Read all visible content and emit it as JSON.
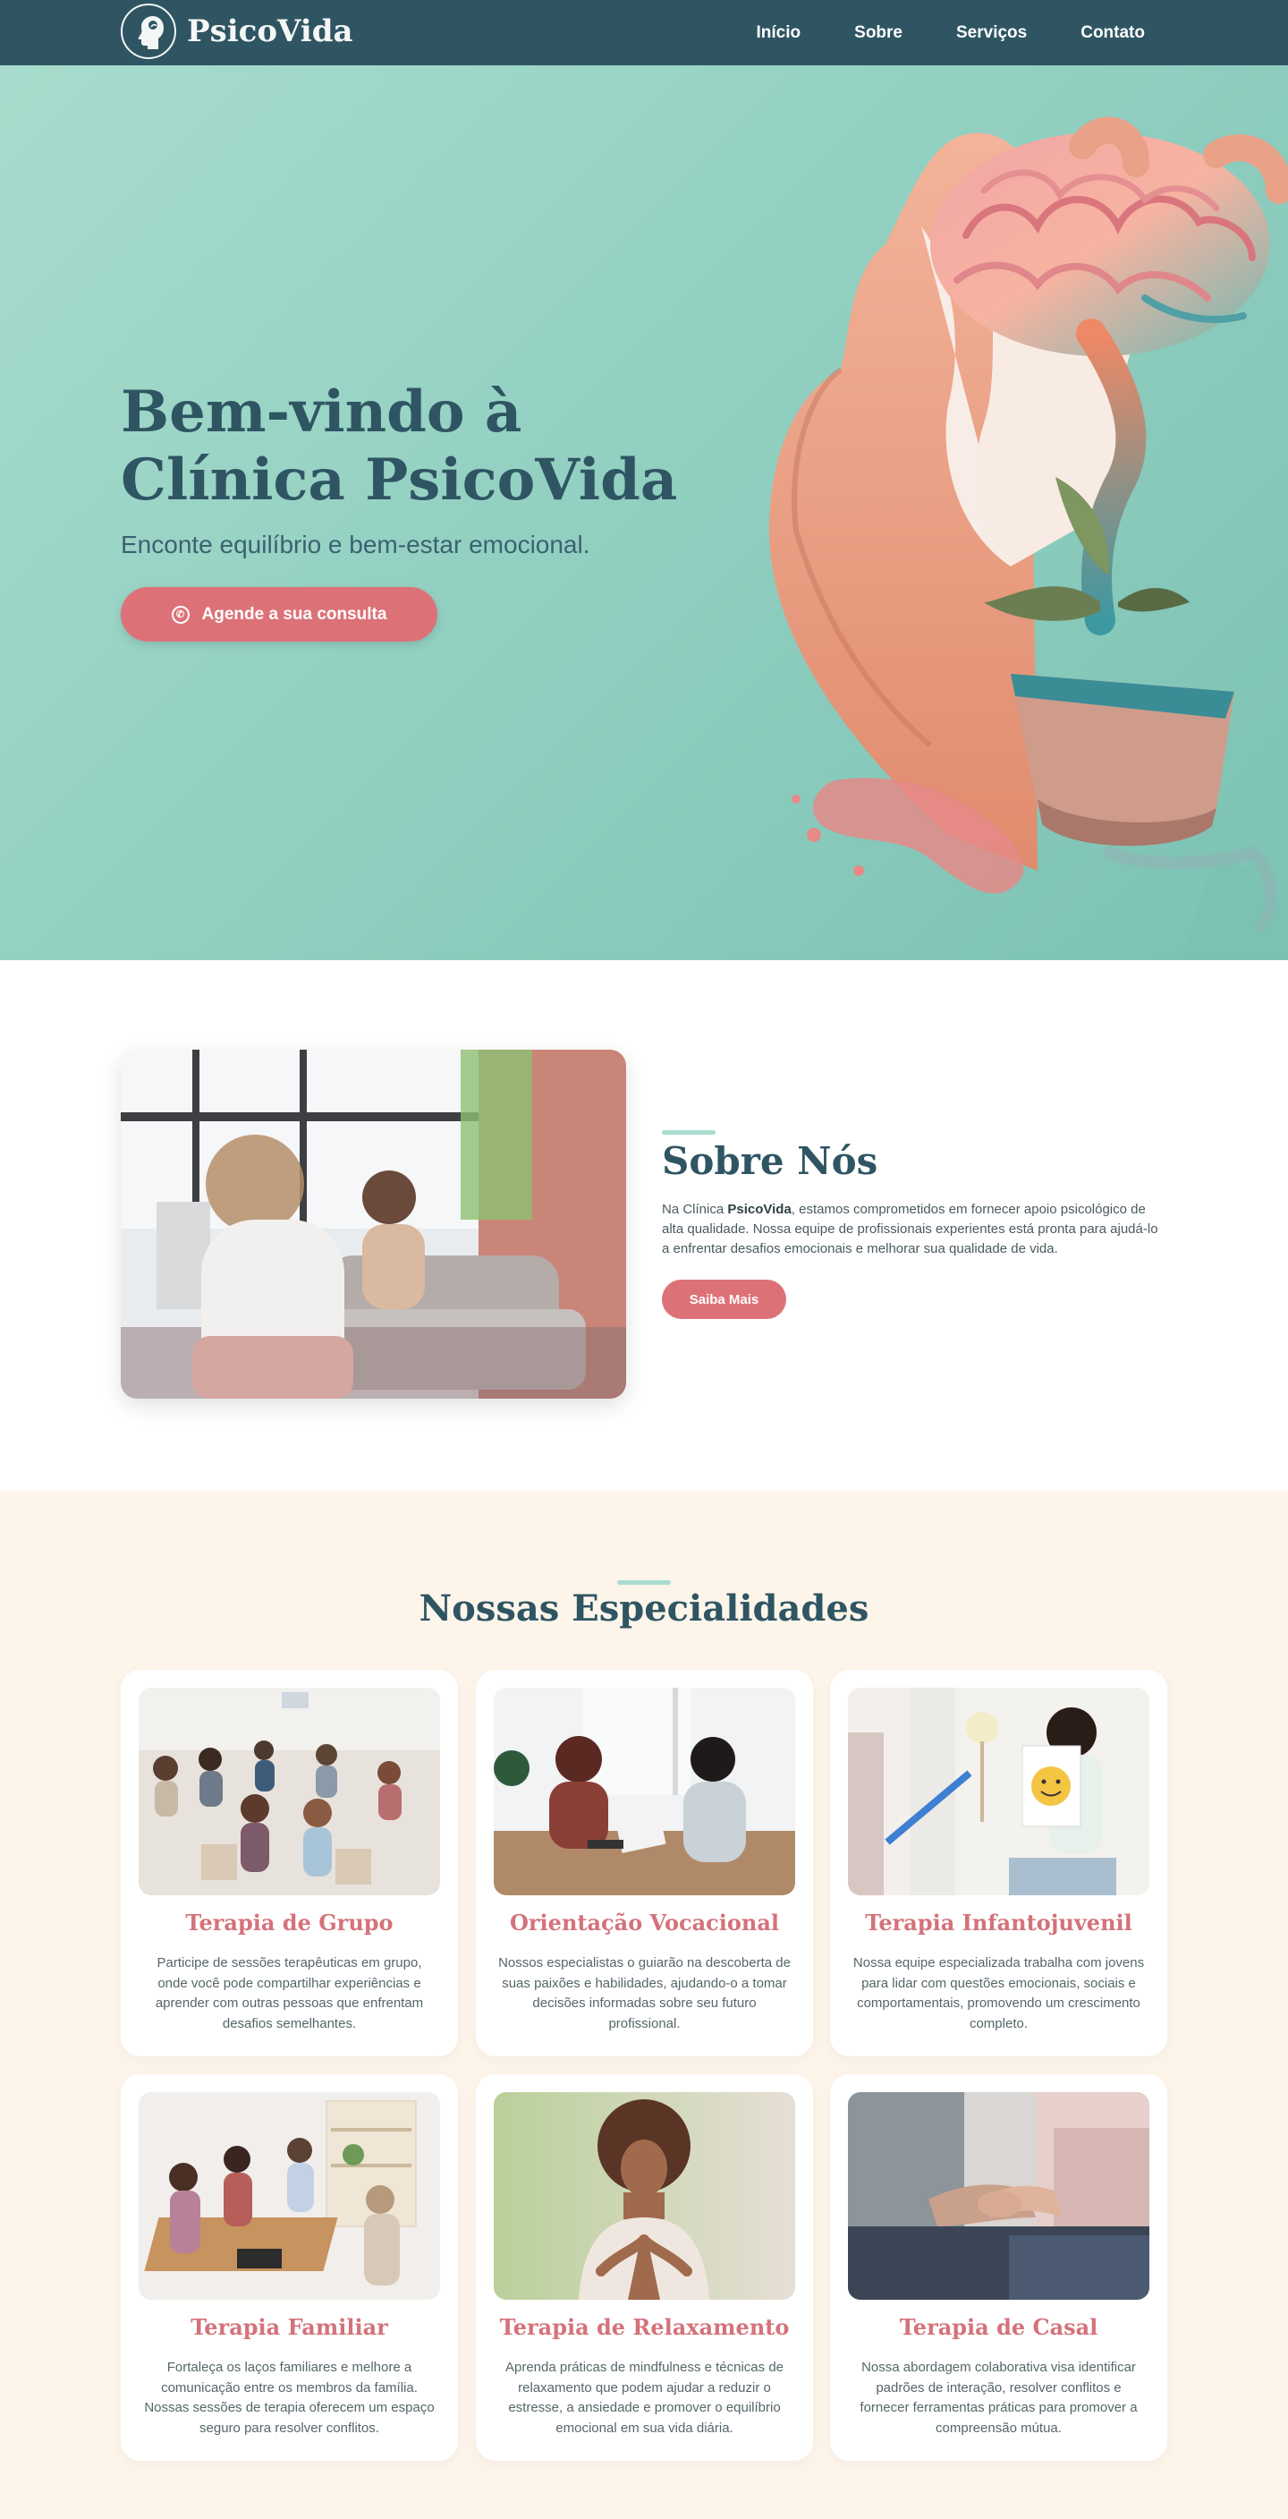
{
  "nav": {
    "brand": "PsicoVida",
    "links": [
      "Início",
      "Sobre",
      "Serviços",
      "Contato"
    ]
  },
  "hero": {
    "title": "Bem-vindo à Clínica PsicoVida",
    "subtitle": "Enconte equilíbrio e bem-estar emocional.",
    "cta_label": "Agende a sua consulta",
    "cta_icon": "whatsapp-icon"
  },
  "about": {
    "title": "Sobre Nós",
    "text_before": "Na Clínica ",
    "text_bold": "PsicoVida",
    "text_after": ", estamos comprometidos em fornecer apoio psicológico de alta qualidade. Nossa equipe de profissionais experientes está pronta para ajudá-lo a enfrentar desafios emocionais e melhorar sua qualidade de vida.",
    "button_label": "Saiba Mais"
  },
  "specialties": {
    "title": "Nossas Especialidades",
    "cards": [
      {
        "title": "Terapia de Grupo",
        "text": "Participe de sessões terapêuticas em grupo, onde você pode compartilhar experiências e aprender com outras pessoas que enfrentam desafios semelhantes."
      },
      {
        "title": "Orientação Vocacional",
        "text": "Nossos especialistas o guiarão na descoberta de suas paixões e habilidades, ajudando-o a tomar decisões informadas sobre seu futuro profissional."
      },
      {
        "title": "Terapia Infantojuvenil",
        "text": "Nossa equipe especializada trabalha com jovens para lidar com questões emocionais, sociais e comportamentais, promovendo um crescimento completo."
      },
      {
        "title": "Terapia Familiar",
        "text": "Fortaleça os laços familiares e melhore a comunicação entre os membros da família. Nossas sessões de terapia oferecem um espaço seguro para resolver conflitos."
      },
      {
        "title": "Terapia de Relaxamento",
        "text": "Aprenda práticas de mindfulness e técnicas de relaxamento que podem ajudar a reduzir o estresse, a ansiedade e promover o equilíbrio emocional em sua vida diária."
      },
      {
        "title": "Terapia de Casal",
        "text": "Nossa abordagem colaborativa visa identificar padrões de interação, resolver conflitos e fornecer ferramentas práticas para promover a compreensão mútua."
      }
    ]
  },
  "colors": {
    "primary": "#2f5563",
    "accent": "#dc7278",
    "hero_bg": "#93d0c2",
    "section_bg": "#fdf5ea"
  }
}
